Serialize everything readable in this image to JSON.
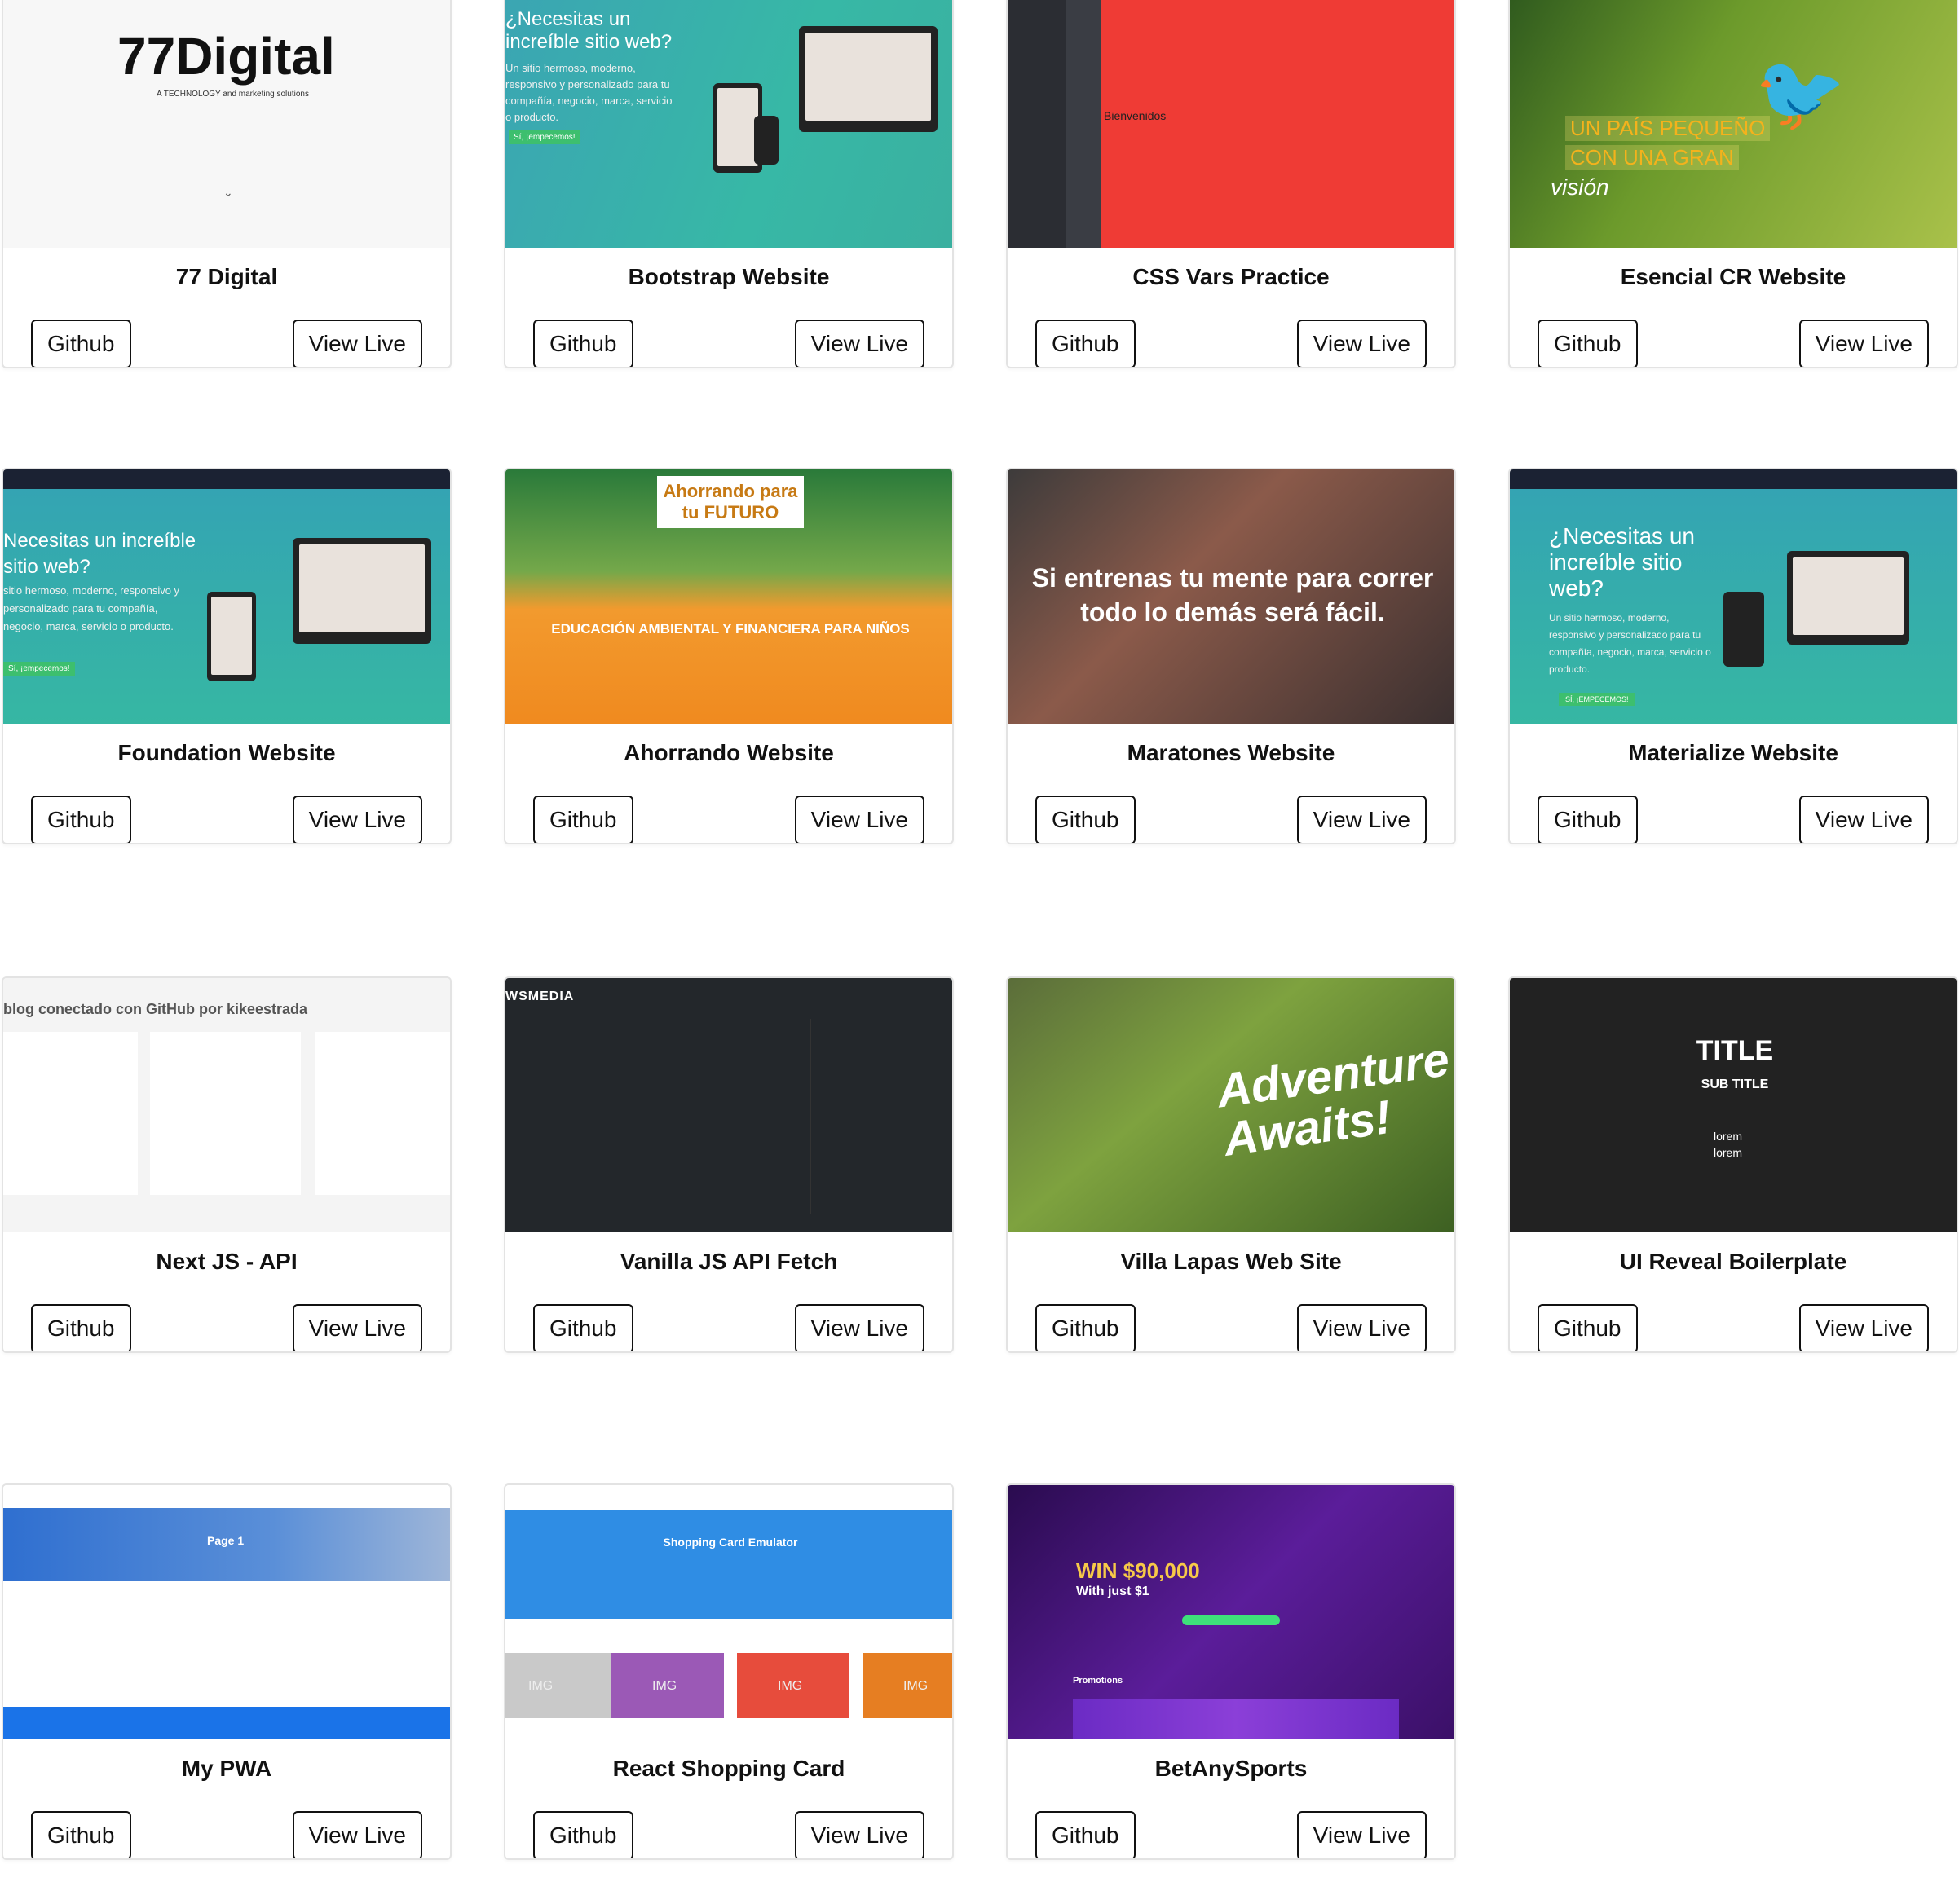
{
  "buttons": {
    "github": "Github",
    "live": "View Live"
  },
  "projects": [
    {
      "title": "77 Digital",
      "thumb_heading": "77Digital",
      "thumb_sub": "A TECHNOLOGY and marketing solutions"
    },
    {
      "title": "Bootstrap Website",
      "thumb_heading": "¿Necesitas un increíble sitio web?",
      "thumb_sub": "Un sitio hermoso, moderno, responsivo y personalizado para tu compañía, negocio, marca, servicio o producto.",
      "thumb_cta": "Sí, ¡empecemos!"
    },
    {
      "title": "CSS Vars Practice",
      "thumb_heading": "Bienvenidos"
    },
    {
      "title": "Esencial CR Website",
      "thumb_heading": "UN PAÍS PEQUEÑO",
      "thumb_sub": "CON UNA GRAN",
      "thumb_cta": "visión"
    },
    {
      "title": "Foundation Website",
      "thumb_heading": "Necesitas un increíble sitio web?",
      "thumb_sub": "sitio hermoso, moderno, responsivo y personalizado para tu compañía, negocio, marca, servicio o producto.",
      "thumb_cta": "Sí, ¡empecemos!"
    },
    {
      "title": "Ahorrando Website",
      "thumb_heading": "Ahorrando para tu FUTURO",
      "thumb_sub": "EDUCACIÓN AMBIENTAL Y FINANCIERA PARA NIÑOS"
    },
    {
      "title": "Maratones Website",
      "thumb_heading": "Si entrenas tu mente para correr todo lo demás será fácil."
    },
    {
      "title": "Materialize Website",
      "thumb_heading": "¿Necesitas un increíble sitio web?",
      "thumb_sub": "Un sitio hermoso, moderno, responsivo y personalizado para tu compañía, negocio, marca, servicio o producto.",
      "thumb_cta": "SÍ, ¡EMPECEMOS!"
    },
    {
      "title": "Next JS - API",
      "thumb_heading": "blog conectado con GitHub por kikeestrada"
    },
    {
      "title": "Vanilla JS API Fetch",
      "thumb_heading": "WSMEDIA"
    },
    {
      "title": "Villa Lapas Web Site",
      "thumb_heading": "Adventure Awaits!"
    },
    {
      "title": "UI Reveal Boilerplate",
      "thumb_heading": "TITLE",
      "thumb_sub": "SUB TITLE",
      "thumb_cta": "lorem"
    },
    {
      "title": "My PWA",
      "thumb_heading": "Page 1"
    },
    {
      "title": "React Shopping Card",
      "thumb_heading": "Shopping Card Emulator",
      "thumb_sub": "IMG"
    },
    {
      "title": "BetAnySports",
      "thumb_heading": "WIN $90,000",
      "thumb_sub": "With just $1",
      "thumb_cta": "Promotions"
    }
  ]
}
